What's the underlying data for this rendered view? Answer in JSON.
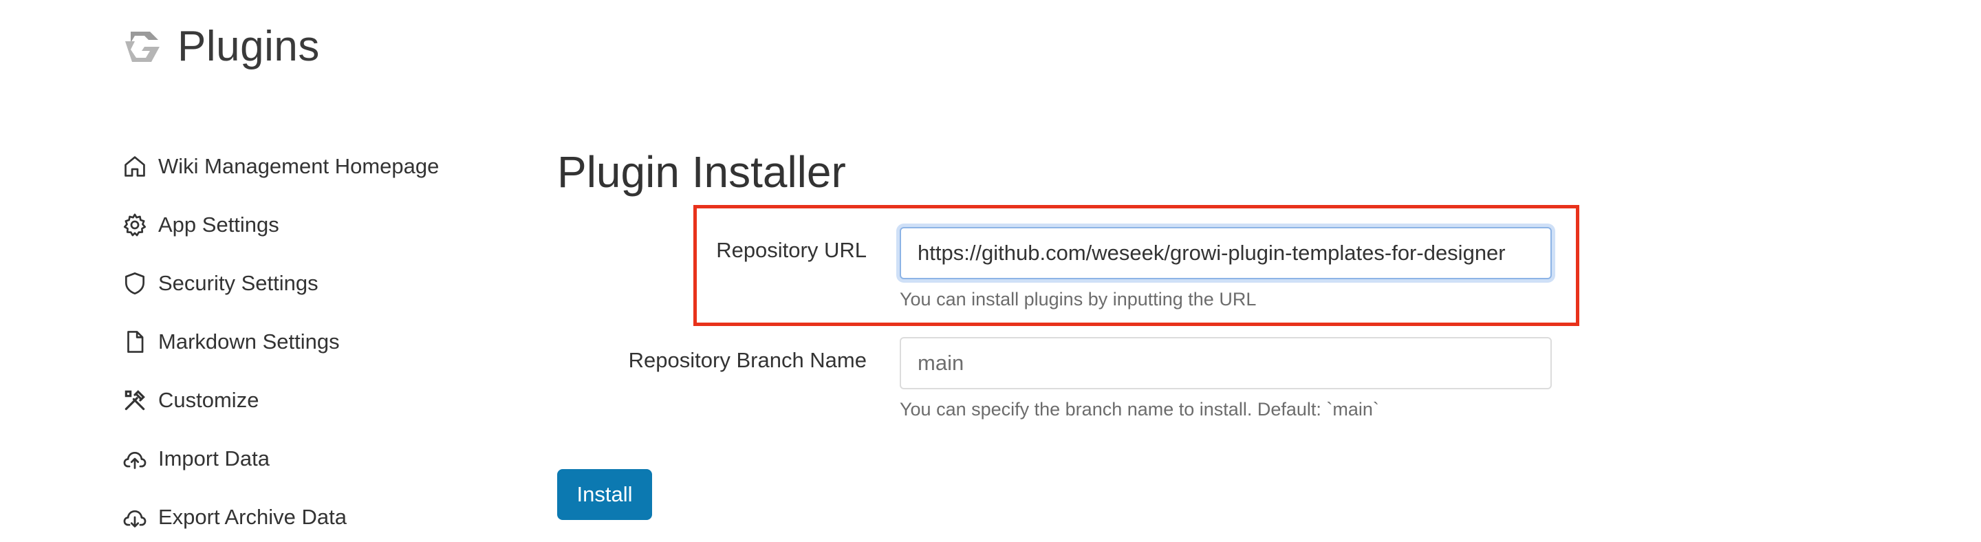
{
  "header": {
    "title": "Plugins",
    "logo_icon": "growi-logo-icon"
  },
  "sidebar": {
    "items": [
      {
        "label": "Wiki Management Homepage",
        "icon": "home-icon"
      },
      {
        "label": "App Settings",
        "icon": "gear-icon"
      },
      {
        "label": "Security Settings",
        "icon": "shield-icon"
      },
      {
        "label": "Markdown Settings",
        "icon": "file-icon"
      },
      {
        "label": "Customize",
        "icon": "tools-icon"
      },
      {
        "label": "Import Data",
        "icon": "cloud-upload-icon"
      },
      {
        "label": "Export Archive Data",
        "icon": "cloud-download-icon"
      }
    ]
  },
  "main": {
    "title": "Plugin Installer",
    "repository_url": {
      "label": "Repository URL",
      "value": "https://github.com/weseek/growi-plugin-templates-for-designer",
      "help": "You can install plugins by inputting the URL"
    },
    "branch": {
      "label": "Repository Branch Name",
      "placeholder": "main",
      "value": "",
      "help": "You can specify the branch name to install. Default: `main`"
    },
    "install_label": "Install"
  },
  "colors": {
    "highlight_border": "#e8321b",
    "primary_button": "#0c79b1",
    "focus_ring": "#cfe0f7"
  }
}
